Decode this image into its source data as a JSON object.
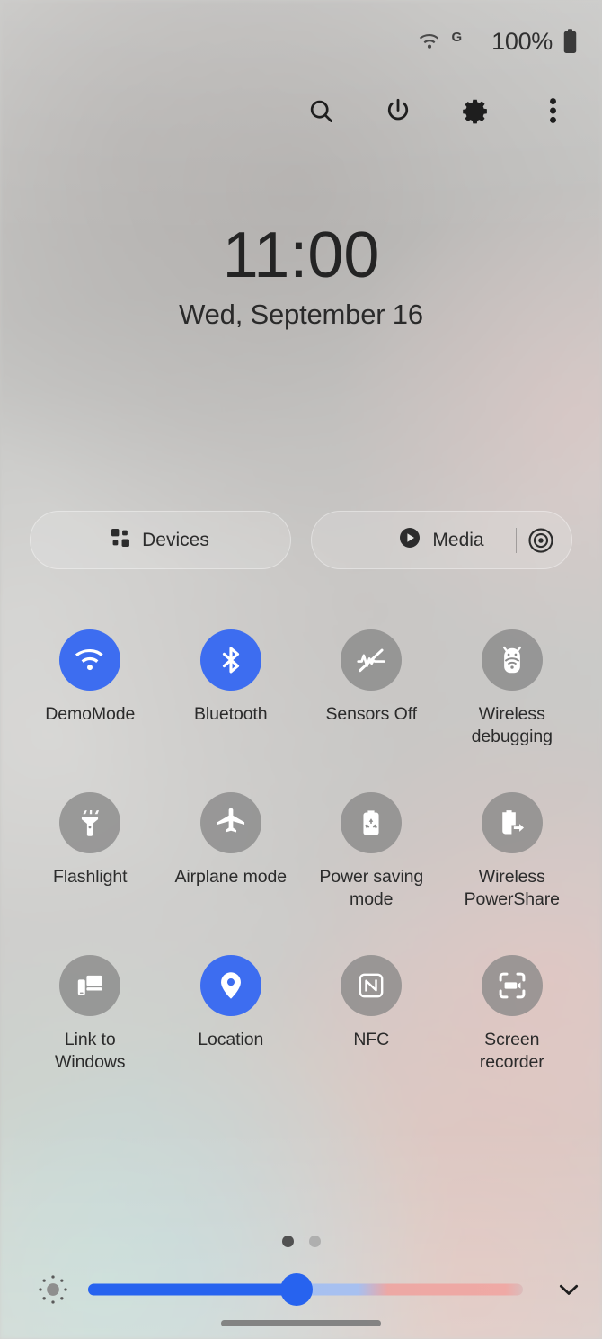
{
  "status_bar": {
    "wifi_icon": "wifi-icon",
    "network_label": "G",
    "battery_percent": "100%",
    "battery_icon": "battery-full-icon"
  },
  "action_bar": {
    "buttons": [
      {
        "name": "search-button",
        "icon": "search-icon"
      },
      {
        "name": "power-button",
        "icon": "power-icon"
      },
      {
        "name": "settings-button",
        "icon": "gear-icon"
      },
      {
        "name": "more-options-button",
        "icon": "overflow-menu-icon"
      }
    ]
  },
  "clock": {
    "time": "11:00",
    "date": "Wed, September 16"
  },
  "pills": {
    "devices": {
      "label": "Devices",
      "icon": "grid-4-icon"
    },
    "media": {
      "label": "Media",
      "icon": "play-icon",
      "output_icon": "media-output-icon"
    }
  },
  "tiles": [
    {
      "label": "DemoMode",
      "icon": "wifi-icon",
      "state": "on"
    },
    {
      "label": "Bluetooth",
      "icon": "bluetooth-icon",
      "state": "on"
    },
    {
      "label": "Sensors Off",
      "icon": "sensors-off-icon",
      "state": "off"
    },
    {
      "label": "Wireless debugging",
      "icon": "android-debug-icon",
      "state": "off"
    },
    {
      "label": "Flashlight",
      "icon": "flashlight-icon",
      "state": "off"
    },
    {
      "label": "Airplane mode",
      "icon": "airplane-icon",
      "state": "off"
    },
    {
      "label": "Power saving mode",
      "icon": "battery-recycle-icon",
      "state": "off"
    },
    {
      "label": "Wireless PowerShare",
      "icon": "battery-share-icon",
      "state": "off"
    },
    {
      "label": "Link to Windows",
      "icon": "phone-monitor-icon",
      "state": "off"
    },
    {
      "label": "Location",
      "icon": "location-pin-icon",
      "state": "on"
    },
    {
      "label": "NFC",
      "icon": "nfc-icon",
      "state": "off"
    },
    {
      "label": "Screen recorder",
      "icon": "screen-record-icon",
      "state": "off"
    }
  ],
  "pager": {
    "total_pages": 2,
    "current_page": 1
  },
  "brightness": {
    "icon": "brightness-sun-icon",
    "value_percent": 48,
    "expand_icon": "chevron-down-icon"
  },
  "nav": {
    "gesture_bar": "gesture-home-bar"
  },
  "colors": {
    "accent_blue": "#3d6df0",
    "slider_blue": "#2763ef",
    "tile_off_gray": "#848484"
  }
}
